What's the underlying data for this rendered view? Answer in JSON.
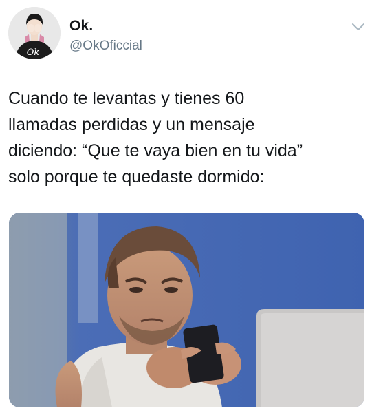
{
  "tweet": {
    "display_name": "Ok.",
    "handle": "@OkOficcial",
    "text": "Cuando te levantas y tienes 60\nllamadas perdidas y un mensaje\ndiciendo: “Que te vaya bien en tu vida”\nsolo porque te quedaste dormido:",
    "avatar_monogram": "Ok",
    "icons": {
      "menu": "chevron-down-icon"
    }
  },
  "colors": {
    "text_primary": "#14171a",
    "text_secondary": "#657786",
    "photo_wall_blue": "#4a6db5"
  }
}
